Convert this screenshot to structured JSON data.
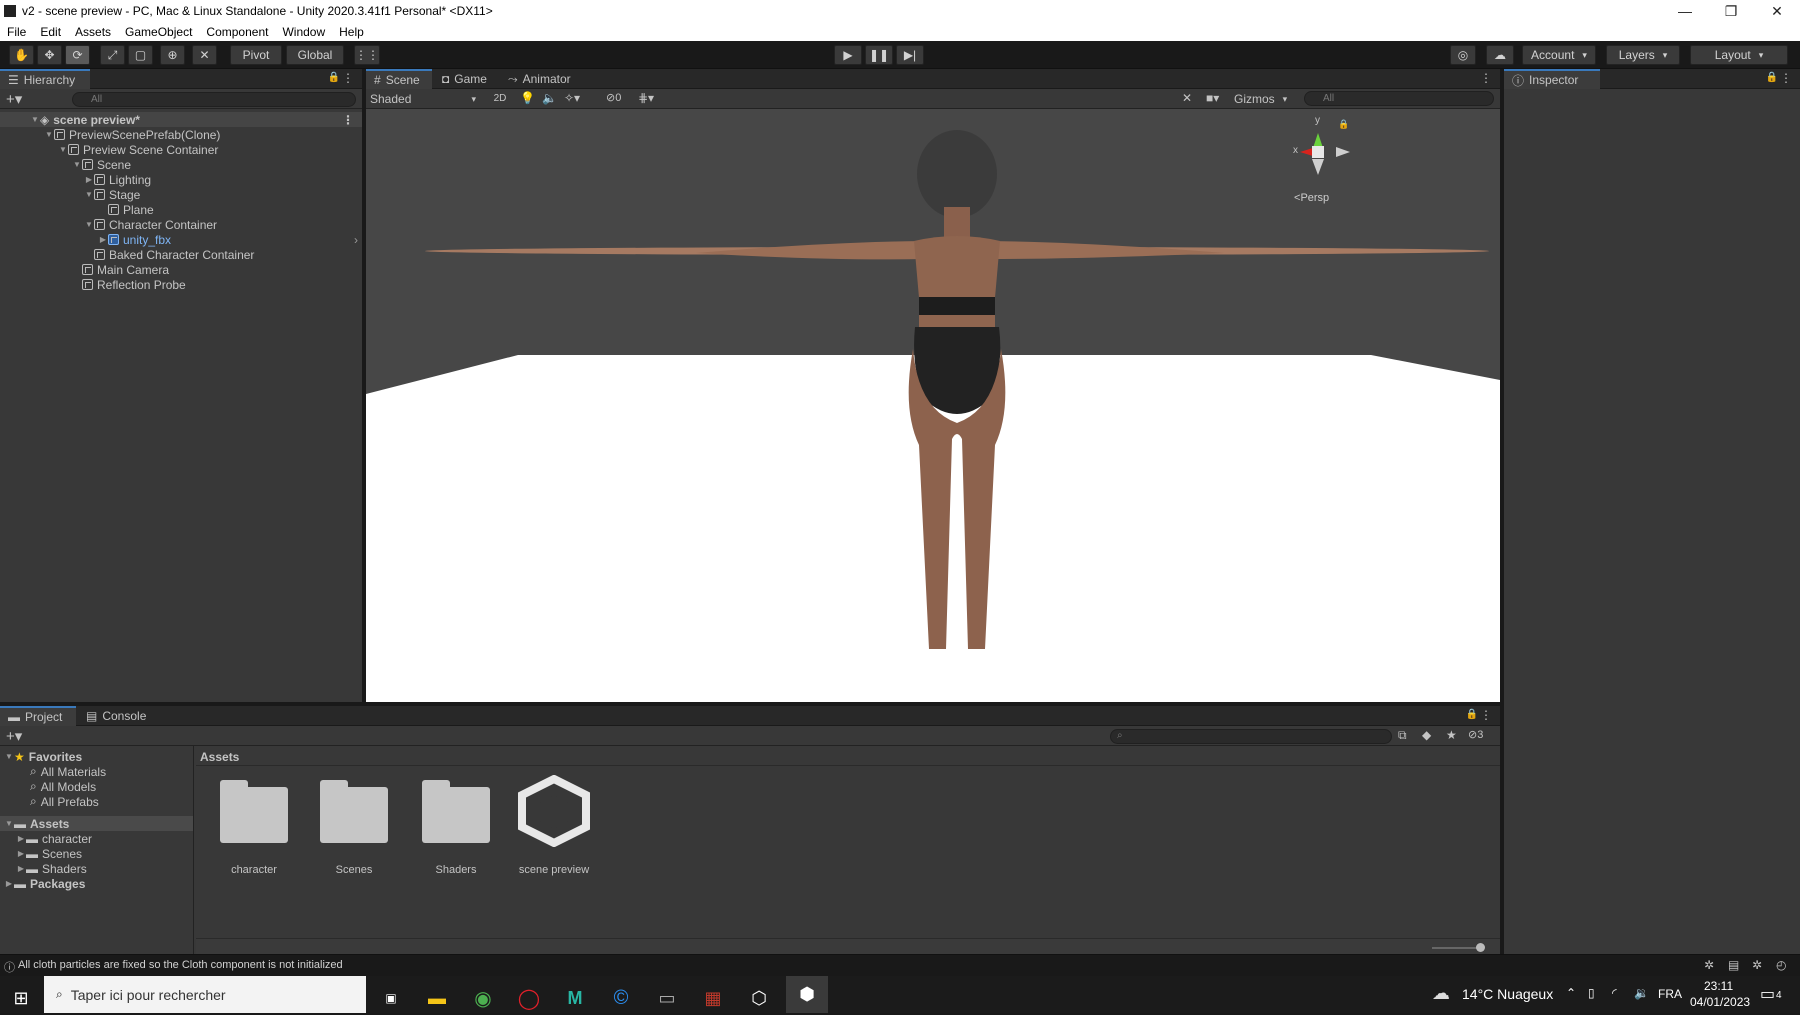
{
  "window": {
    "title": "v2 - scene preview - PC, Mac & Linux Standalone - Unity 2020.3.41f1 Personal* <DX11>"
  },
  "menu": [
    "File",
    "Edit",
    "Assets",
    "GameObject",
    "Component",
    "Window",
    "Help"
  ],
  "toolbar": {
    "pivot": "Pivot",
    "global": "Global",
    "account": "Account",
    "layers": "Layers",
    "layout": "Layout"
  },
  "hierarchy": {
    "tab": "Hierarchy",
    "search_placeholder": "All",
    "items": [
      {
        "label": "scene preview*",
        "depth": 0
      },
      {
        "label": "PreviewScenePrefab(Clone)",
        "depth": 1
      },
      {
        "label": "Preview Scene Container",
        "depth": 2
      },
      {
        "label": "Scene",
        "depth": 3
      },
      {
        "label": "Lighting",
        "depth": 4
      },
      {
        "label": "Stage",
        "depth": 4
      },
      {
        "label": "Plane",
        "depth": 5
      },
      {
        "label": "Character Container",
        "depth": 4
      },
      {
        "label": "unity_fbx",
        "depth": 5
      },
      {
        "label": "Baked Character Container",
        "depth": 4
      },
      {
        "label": "Main Camera",
        "depth": 3
      },
      {
        "label": "Reflection Probe",
        "depth": 3
      }
    ]
  },
  "scene": {
    "tabs": [
      "Scene",
      "Game",
      "Animator"
    ],
    "shading": "Shaded",
    "mode_2d": "2D",
    "hidden_count": "0",
    "gizmos": "Gizmos",
    "search_placeholder": "All",
    "axis_x": "x",
    "axis_y": "y",
    "persp": "Persp"
  },
  "inspector": {
    "tab": "Inspector"
  },
  "project": {
    "tabs": [
      "Project",
      "Console"
    ],
    "favorites": "Favorites",
    "fav_items": [
      "All Materials",
      "All Models",
      "All Prefabs"
    ],
    "assets_root": "Assets",
    "asset_folders": [
      "character",
      "Scenes",
      "Shaders"
    ],
    "packages": "Packages",
    "breadcrumb": "Assets",
    "grid": [
      "character",
      "Scenes",
      "Shaders",
      "scene preview"
    ],
    "hidden_count": "3"
  },
  "status": {
    "message": "All cloth particles are fixed so the Cloth component is not initialized"
  },
  "taskbar": {
    "search_placeholder": "Taper ici pour rechercher",
    "weather": "14°C  Nuageux",
    "lang": "FRA",
    "time": "23:11",
    "date": "04/01/2023",
    "notifications": "4"
  }
}
